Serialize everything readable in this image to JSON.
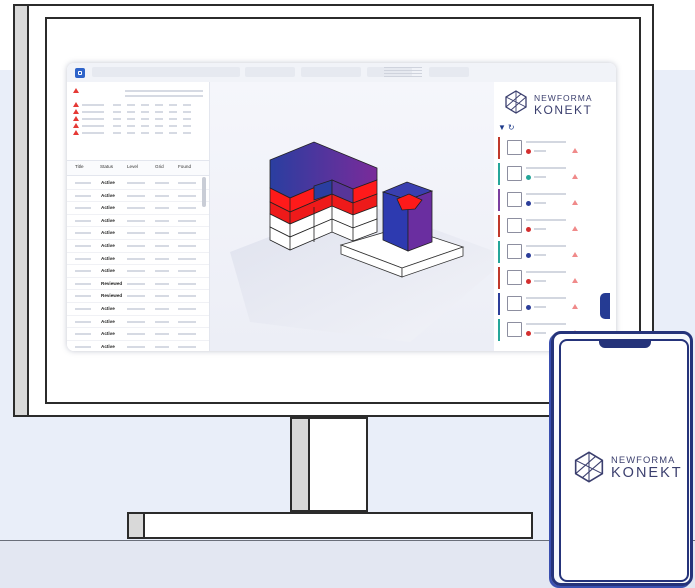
{
  "app": {
    "left_panel": {
      "columns": [
        "Title",
        "Status",
        "Level",
        "Grid",
        "Found"
      ],
      "rows": [
        {
          "status": "Active"
        },
        {
          "status": "Active"
        },
        {
          "status": "Active"
        },
        {
          "status": "Active"
        },
        {
          "status": "Active"
        },
        {
          "status": "Active"
        },
        {
          "status": "Active"
        },
        {
          "status": "Active"
        },
        {
          "status": "Reviewed"
        },
        {
          "status": "Reviewed"
        },
        {
          "status": "Active"
        },
        {
          "status": "Active"
        },
        {
          "status": "Active"
        },
        {
          "status": "Active"
        }
      ]
    },
    "right_panel": {
      "brand_top": "NEWFORMA",
      "brand_bottom": "KONEKT",
      "cards": [
        {
          "bar_color": "#c0392b",
          "dot_color": "#d32f2f",
          "icon": "drawing-thumbnail-icon"
        },
        {
          "bar_color": "#26a69a",
          "dot_color": "#26a69a",
          "icon": "blank-thumbnail-icon"
        },
        {
          "bar_color": "#7b3fa0",
          "dot_color": "#2c3e9a",
          "icon": "equipment-thumbnail-icon"
        },
        {
          "bar_color": "#c0392b",
          "dot_color": "#d32f2f",
          "icon": "photo-thumbnail-icon"
        },
        {
          "bar_color": "#26a69a",
          "dot_color": "#2c3e9a",
          "icon": "blank-thumbnail-icon"
        },
        {
          "bar_color": "#c0392b",
          "dot_color": "#d32f2f",
          "icon": "blank-thumbnail-icon"
        },
        {
          "bar_color": "#2c3e9a",
          "dot_color": "#2c3e9a",
          "icon": "door-thumbnail-icon"
        },
        {
          "bar_color": "#26a69a",
          "dot_color": "#d32f2f",
          "icon": "blank-thumbnail-icon"
        }
      ]
    }
  },
  "phone": {
    "brand_top": "NEWFORMA",
    "brand_bottom": "KONEKT"
  },
  "colors": {
    "brand_navy": "#25337a",
    "clash_red": "#ff1a1a",
    "model_blue": "#2a3ea0",
    "model_purple": "#6a2ea0"
  }
}
